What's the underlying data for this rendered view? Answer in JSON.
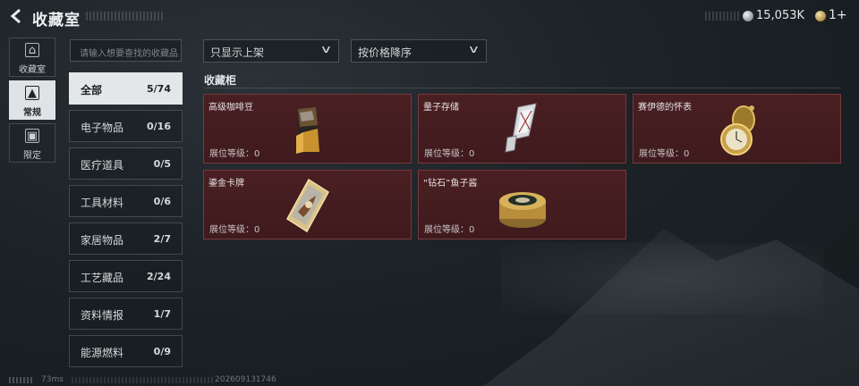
{
  "header": {
    "title": "收藏室",
    "currency_silver": "15,053K",
    "currency_gold": "1+"
  },
  "side_nav": [
    {
      "label": "收藏室",
      "icon": "collection-icon"
    },
    {
      "label": "常规",
      "icon": "image-icon"
    },
    {
      "label": "限定",
      "icon": "limited-image-icon"
    }
  ],
  "search": {
    "placeholder": "请输入想要查找的收藏品"
  },
  "categories": [
    {
      "name": "全部",
      "count": "5/74"
    },
    {
      "name": "电子物品",
      "count": "0/16"
    },
    {
      "name": "医疗道具",
      "count": "0/5"
    },
    {
      "name": "工具材料",
      "count": "0/6"
    },
    {
      "name": "家居物品",
      "count": "2/7"
    },
    {
      "name": "工艺藏品",
      "count": "2/24"
    },
    {
      "name": "资料情报",
      "count": "1/7"
    },
    {
      "name": "能源燃料",
      "count": "0/9"
    }
  ],
  "filters": {
    "shelf": "只显示上架",
    "sort": "按价格降序"
  },
  "section_title": "收藏柜",
  "items": [
    {
      "name": "高级咖啡豆",
      "level": "展位等级：0",
      "icon": "coffee-bag-icon"
    },
    {
      "name": "量子存储",
      "level": "展位等级：0",
      "icon": "usb-drive-icon"
    },
    {
      "name": "赛伊德的怀表",
      "level": "展位等级：0",
      "icon": "pocket-watch-icon"
    },
    {
      "name": "鎏金卡牌",
      "level": "展位等级：0",
      "icon": "gilded-card-icon"
    },
    {
      "name": "“钻石”鱼子酱",
      "level": "展位等级：0",
      "icon": "caviar-tin-icon"
    }
  ],
  "footer": {
    "ping": "73ms",
    "build": "202609131746"
  },
  "colors": {
    "card_bg": "#4a1f22",
    "active_tab": "#e4e7e8"
  }
}
